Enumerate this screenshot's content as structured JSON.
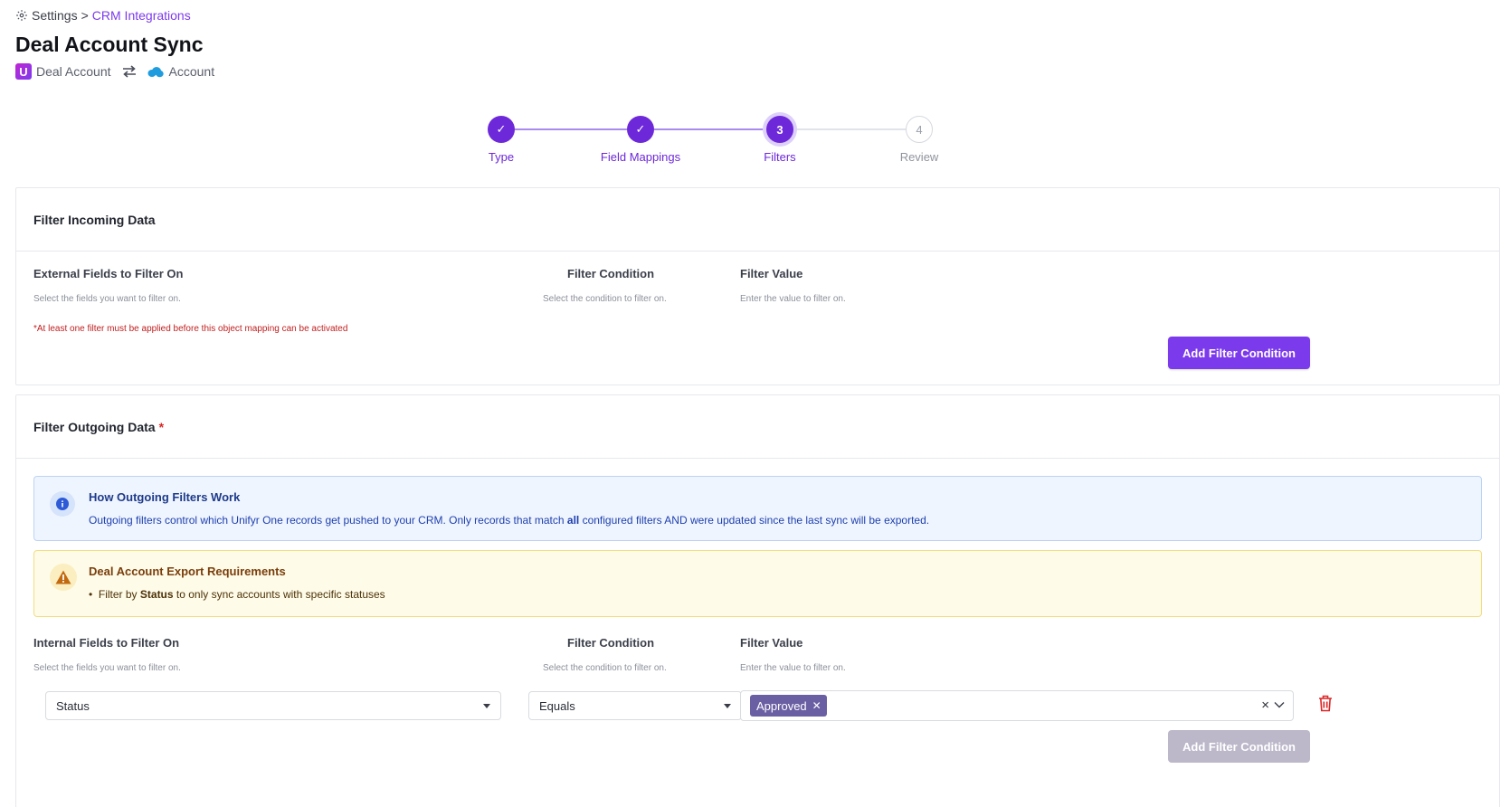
{
  "breadcrumb": {
    "root": "Settings",
    "separator": ">",
    "current": "CRM Integrations"
  },
  "page": {
    "title": "Deal Account Sync",
    "source_object": "Deal Account",
    "target_object": "Account",
    "source_logo_letter": "U"
  },
  "stepper": {
    "steps": [
      {
        "label": "Type",
        "marker": "✓",
        "state": "done"
      },
      {
        "label": "Field Mappings",
        "marker": "✓",
        "state": "done"
      },
      {
        "label": "Filters",
        "marker": "3",
        "state": "current"
      },
      {
        "label": "Review",
        "marker": "4",
        "state": "todo"
      }
    ]
  },
  "incoming": {
    "title": "Filter Incoming Data",
    "columns": [
      {
        "heading": "External Fields to Filter On",
        "hint": "Select the fields you want to filter on."
      },
      {
        "heading": "Filter Condition",
        "hint": "Select the condition to filter on."
      },
      {
        "heading": "Filter Value",
        "hint": "Enter the value to filter on."
      }
    ],
    "warning": "*At least one filter must be applied before this object mapping can be activated",
    "add_button": "Add Filter Condition"
  },
  "outgoing": {
    "title": "Filter Outgoing Data",
    "required_mark": "*",
    "info": {
      "title": "How Outgoing Filters Work",
      "body_before": "Outgoing filters control which Unifyr One records get pushed to your CRM. Only records that match ",
      "body_bold": "all",
      "body_after": " configured filters AND were updated since the last sync will be exported."
    },
    "requirements": {
      "title": "Deal Account Export Requirements",
      "item_before": "Filter by ",
      "item_bold": "Status",
      "item_after": " to only sync accounts with specific statuses"
    },
    "columns": [
      {
        "heading": "Internal Fields to Filter On",
        "hint": "Select the fields you want to filter on."
      },
      {
        "heading": "Filter Condition",
        "hint": "Select the condition to filter on."
      },
      {
        "heading": "Filter Value",
        "hint": "Enter the value to filter on."
      }
    ],
    "row": {
      "field": "Status",
      "condition": "Equals",
      "values": [
        "Approved"
      ]
    },
    "add_button": "Add Filter Condition"
  },
  "colors": {
    "accent": "#7c3aed",
    "step_active": "#6d28d9",
    "danger": "#dc2626",
    "chip": "#6b5fa3"
  },
  "icons": [
    "gear-icon",
    "swap-icon",
    "salesforce-cloud-icon",
    "check-icon",
    "info-icon",
    "warning-icon",
    "chevron-down-icon",
    "clear-icon",
    "trash-icon"
  ]
}
